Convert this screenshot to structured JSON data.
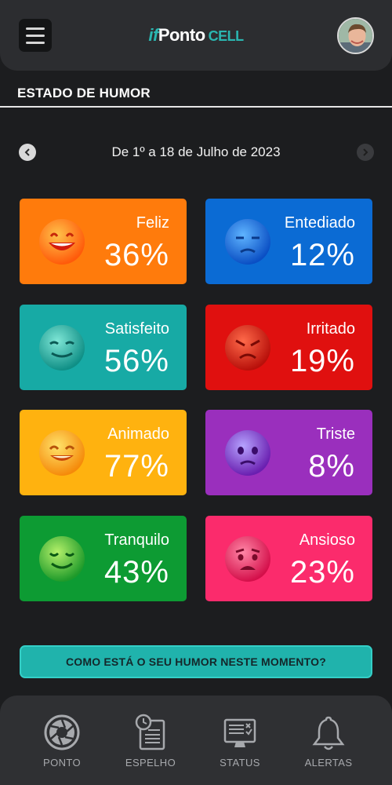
{
  "header": {
    "logo_prefix": "if",
    "logo_main": "Ponto",
    "logo_suffix": "CELL"
  },
  "section_title": "ESTADO DE HUMOR",
  "date_range": "De 1º a 18 de Julho de 2023",
  "moods": [
    {
      "name": "Feliz",
      "percent": "36%",
      "color": "#ff7b0c",
      "emoji": "happy-face-icon"
    },
    {
      "name": "Entediado",
      "percent": "12%",
      "color": "#0b6bd4",
      "emoji": "bored-face-icon"
    },
    {
      "name": "Satisfeito",
      "percent": "56%",
      "color": "#17aaa5",
      "emoji": "satisfied-face-icon"
    },
    {
      "name": "Irritado",
      "percent": "19%",
      "color": "#e0100f",
      "emoji": "angry-face-icon"
    },
    {
      "name": "Animado",
      "percent": "77%",
      "color": "#ffb20f",
      "emoji": "excited-face-icon"
    },
    {
      "name": "Triste",
      "percent": "8%",
      "color": "#9a2fbd",
      "emoji": "sad-face-icon"
    },
    {
      "name": "Tranquilo",
      "percent": "43%",
      "color": "#0d9b33",
      "emoji": "calm-face-icon"
    },
    {
      "name": "Ansioso",
      "percent": "23%",
      "color": "#fb2b6c",
      "emoji": "anxious-face-icon"
    }
  ],
  "mood_button_label": "COMO ESTÁ O SEU HUMOR NESTE MOMENTO?",
  "nav": [
    {
      "label": "PONTO",
      "icon": "camera-shutter-icon"
    },
    {
      "label": "ESPELHO",
      "icon": "timesheet-icon"
    },
    {
      "label": "STATUS",
      "icon": "monitor-status-icon"
    },
    {
      "label": "ALERTAS",
      "icon": "bell-icon"
    }
  ]
}
